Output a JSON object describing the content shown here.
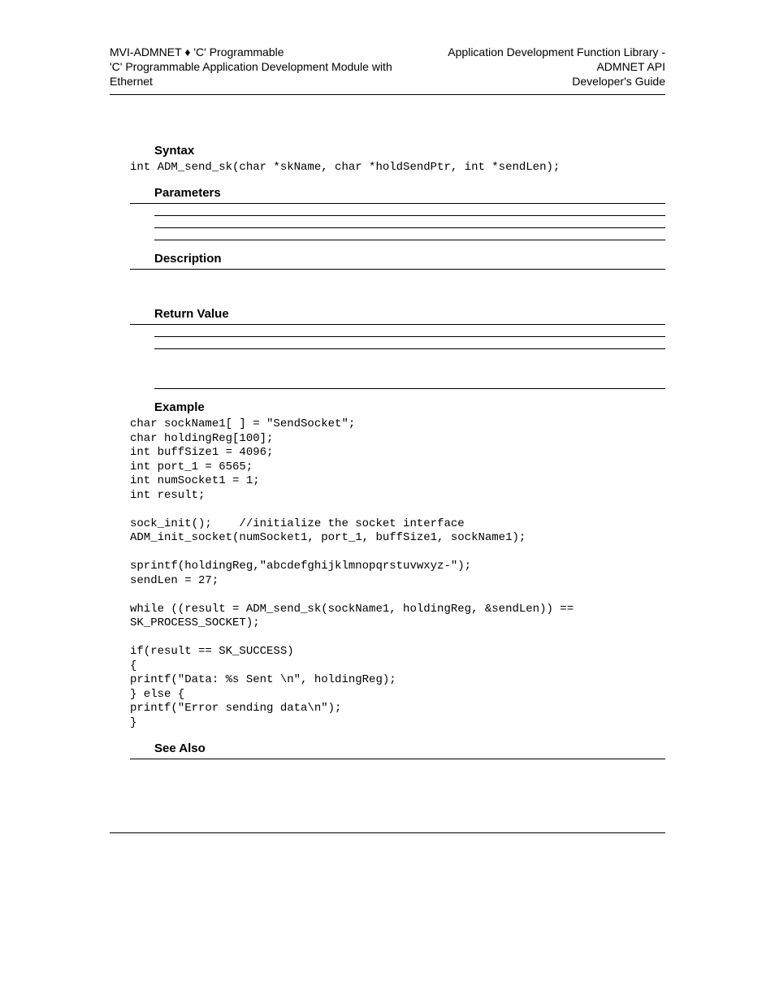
{
  "header": {
    "left_line1_a": "MVI-ADMNET ",
    "left_line1_b": " 'C' Programmable",
    "left_line2": "'C' Programmable Application Development Module with Ethernet",
    "right_line1": "Application Development Function Library - ADMNET API",
    "right_line2": "Developer's Guide"
  },
  "sections": {
    "syntax": "Syntax",
    "parameters": "Parameters",
    "description": "Description",
    "return_value": "Return Value",
    "example": "Example",
    "see_also": "See Also"
  },
  "code": {
    "syntax": "int ADM_send_sk(char *skName, char *holdSendPtr, int *sendLen);",
    "example": "char sockName1[ ] = \"SendSocket\";\nchar holdingReg[100];\nint buffSize1 = 4096;\nint port_1 = 6565;\nint numSocket1 = 1;\nint result;\n\nsock_init();    //initialize the socket interface\nADM_init_socket(numSocket1, port_1, buffSize1, sockName1);\n\nsprintf(holdingReg,\"abcdefghijklmnopqrstuvwxyz-\");\nsendLen = 27;\n\nwhile ((result = ADM_send_sk(sockName1, holdingReg, &sendLen)) ==\nSK_PROCESS_SOCKET);\n\nif(result == SK_SUCCESS)\n{\nprintf(\"Data: %s Sent \\n\", holdingReg);\n} else {\nprintf(\"Error sending data\\n\");\n}"
  }
}
